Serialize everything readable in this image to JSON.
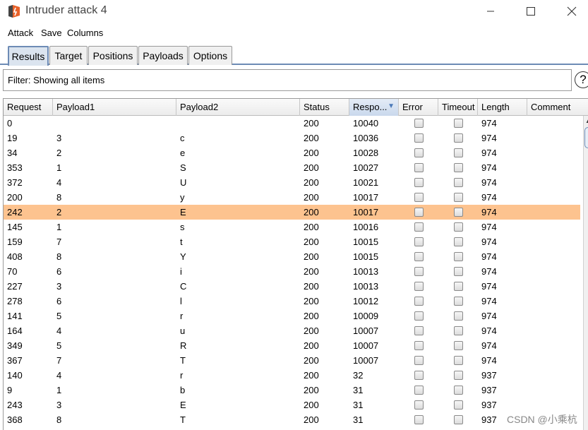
{
  "window": {
    "title": "Intruder attack 4"
  },
  "menu": [
    "Attack",
    "Save",
    "Columns"
  ],
  "tabs": [
    "Results",
    "Target",
    "Positions",
    "Payloads",
    "Options"
  ],
  "filter": {
    "text": "Filter: Showing all items"
  },
  "help_label": "?",
  "columns": [
    "Request",
    "Payload1",
    "Payload2",
    "Status",
    "Respo...",
    "Error",
    "Timeout",
    "Length",
    "Comment"
  ],
  "rows": [
    {
      "request": "0",
      "p1": "",
      "p2": "",
      "status": "200",
      "resp": "10040",
      "length": "974"
    },
    {
      "request": "19",
      "p1": "3",
      "p2": "c",
      "status": "200",
      "resp": "10036",
      "length": "974"
    },
    {
      "request": "34",
      "p1": "2",
      "p2": "e",
      "status": "200",
      "resp": "10028",
      "length": "974"
    },
    {
      "request": "353",
      "p1": "1",
      "p2": "S",
      "status": "200",
      "resp": "10027",
      "length": "974"
    },
    {
      "request": "372",
      "p1": "4",
      "p2": "U",
      "status": "200",
      "resp": "10021",
      "length": "974"
    },
    {
      "request": "200",
      "p1": "8",
      "p2": "y",
      "status": "200",
      "resp": "10017",
      "length": "974"
    },
    {
      "request": "242",
      "p1": "2",
      "p2": "E",
      "status": "200",
      "resp": "10017",
      "length": "974",
      "selected": true
    },
    {
      "request": "145",
      "p1": "1",
      "p2": "s",
      "status": "200",
      "resp": "10016",
      "length": "974"
    },
    {
      "request": "159",
      "p1": "7",
      "p2": "t",
      "status": "200",
      "resp": "10015",
      "length": "974"
    },
    {
      "request": "408",
      "p1": "8",
      "p2": "Y",
      "status": "200",
      "resp": "10015",
      "length": "974"
    },
    {
      "request": "70",
      "p1": "6",
      "p2": "i",
      "status": "200",
      "resp": "10013",
      "length": "974"
    },
    {
      "request": "227",
      "p1": "3",
      "p2": "C",
      "status": "200",
      "resp": "10013",
      "length": "974"
    },
    {
      "request": "278",
      "p1": "6",
      "p2": "l",
      "status": "200",
      "resp": "10012",
      "length": "974"
    },
    {
      "request": "141",
      "p1": "5",
      "p2": "r",
      "status": "200",
      "resp": "10009",
      "length": "974"
    },
    {
      "request": "164",
      "p1": "4",
      "p2": "u",
      "status": "200",
      "resp": "10007",
      "length": "974"
    },
    {
      "request": "349",
      "p1": "5",
      "p2": "R",
      "status": "200",
      "resp": "10007",
      "length": "974"
    },
    {
      "request": "367",
      "p1": "7",
      "p2": "T",
      "status": "200",
      "resp": "10007",
      "length": "974"
    },
    {
      "request": "140",
      "p1": "4",
      "p2": "r",
      "status": "200",
      "resp": "32",
      "length": "937"
    },
    {
      "request": "9",
      "p1": "1",
      "p2": "b",
      "status": "200",
      "resp": "31",
      "length": "937"
    },
    {
      "request": "243",
      "p1": "3",
      "p2": "E",
      "status": "200",
      "resp": "31",
      "length": "937"
    },
    {
      "request": "368",
      "p1": "8",
      "p2": "T",
      "status": "200",
      "resp": "31",
      "length": "937"
    }
  ],
  "watermark": "CSDN @小乘杭",
  "colors": {
    "selected_row": "#fdc38f",
    "active_tab": "#dbe4ef",
    "accent": "#6d8bb5",
    "logo": "#e8622a"
  }
}
